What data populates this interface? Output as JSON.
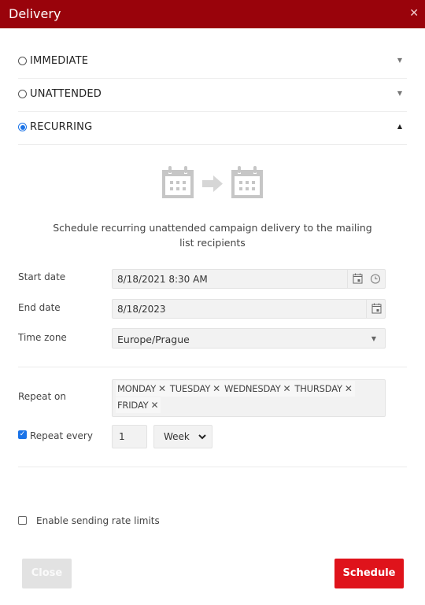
{
  "dialog": {
    "title": "Delivery",
    "close_icon": "close-icon"
  },
  "delivery_options": [
    {
      "label": "IMMEDIATE",
      "selected": false,
      "expanded": false
    },
    {
      "label": "UNATTENDED",
      "selected": false,
      "expanded": false
    },
    {
      "label": "RECURRING",
      "selected": true,
      "expanded": true
    }
  ],
  "recurring": {
    "illustration": [
      "calendar-icon",
      "arrow-right-icon",
      "calendar-icon"
    ],
    "description": "Schedule recurring unattended campaign delivery to the mailing list recipients",
    "start_date": {
      "label": "Start date",
      "value": "8/18/2021 8:30 AM"
    },
    "end_date": {
      "label": "End date",
      "value": "8/18/2023"
    },
    "time_zone": {
      "label": "Time zone",
      "value": "Europe/Prague"
    },
    "repeat_on": {
      "label": "Repeat on",
      "days": [
        "MONDAY",
        "TUESDAY",
        "WEDNESDAY",
        "THURSDAY",
        "FRIDAY"
      ]
    },
    "repeat_every": {
      "label": "Repeat every",
      "checked": true,
      "count": "1",
      "unit": "Week"
    }
  },
  "rate_limits": {
    "label": "Enable sending rate limits",
    "checked": false
  },
  "footer": {
    "close_label": "Close",
    "schedule_label": "Schedule"
  },
  "colors": {
    "header": "#99030b",
    "primary_button": "#df131b",
    "radio_selected": "#1a73e8"
  }
}
